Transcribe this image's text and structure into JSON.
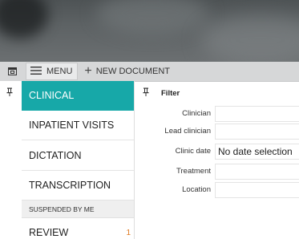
{
  "toolbar": {
    "menu_label": "MENU",
    "new_document_label": "NEW DOCUMENT"
  },
  "sidebar": {
    "items": [
      {
        "label": "CLINICAL",
        "active": true
      },
      {
        "label": "INPATIENT VISITS"
      },
      {
        "label": "DICTATION"
      },
      {
        "label": "TRANSCRIPTION"
      }
    ],
    "section_label": "SUSPENDED BY ME",
    "review": {
      "label": "REVIEW",
      "count": "1"
    }
  },
  "filter": {
    "title": "Filter",
    "fields": [
      {
        "label": "Clinician",
        "value": ""
      },
      {
        "label": "Lead clinician",
        "value": ""
      },
      {
        "label": "Clinic date",
        "value": "No date selection"
      },
      {
        "label": "Treatment",
        "value": ""
      },
      {
        "label": "Location",
        "value": ""
      }
    ]
  },
  "colors": {
    "accent": "#17a8a8",
    "toolbar_bg": "#d6d7d8",
    "badge": "#e07a22"
  },
  "icons": [
    "window-icon",
    "hamburger-icon",
    "plus-icon",
    "pin-icon"
  ]
}
